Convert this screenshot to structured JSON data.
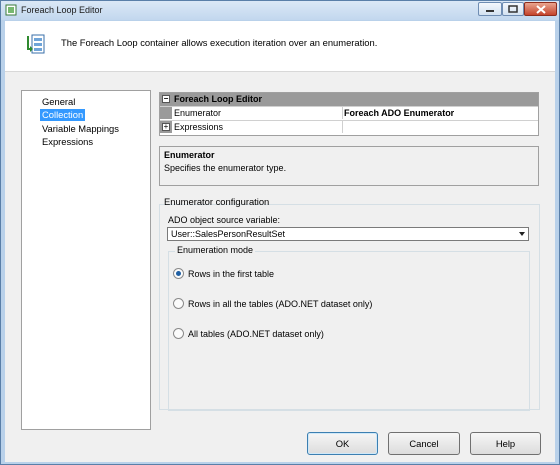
{
  "window": {
    "title": "Foreach Loop Editor"
  },
  "header": {
    "description": "The Foreach Loop container allows execution iteration over an enumeration."
  },
  "nav": {
    "items": [
      "General",
      "Collection",
      "Variable Mappings",
      "Expressions"
    ],
    "selected": "Collection"
  },
  "grid": {
    "category": "Foreach Loop Editor",
    "rows": [
      {
        "label": "Enumerator",
        "value": "Foreach ADO Enumerator"
      },
      {
        "label": "Expressions",
        "value": ""
      }
    ]
  },
  "description": {
    "title": "Enumerator",
    "text": "Specifies the enumerator type."
  },
  "config": {
    "title": "Enumerator configuration",
    "source_label": "ADO object source variable:",
    "source_value": "User::SalesPersonResultSet",
    "mode_title": "Enumeration mode",
    "modes": [
      {
        "label": "Rows in the first table",
        "selected": true
      },
      {
        "label": "Rows in all the tables (ADO.NET dataset only)",
        "selected": false
      },
      {
        "label": "All tables (ADO.NET dataset only)",
        "selected": false
      }
    ]
  },
  "buttons": {
    "ok": "OK",
    "cancel": "Cancel",
    "help": "Help"
  },
  "colors": {
    "selection": "#3399ff",
    "title_bar": "#c2d7ee",
    "close_button": "#c4432c"
  },
  "icons": {
    "window": "foreach-loop-icon",
    "header": "foreach-loop-container-icon"
  }
}
